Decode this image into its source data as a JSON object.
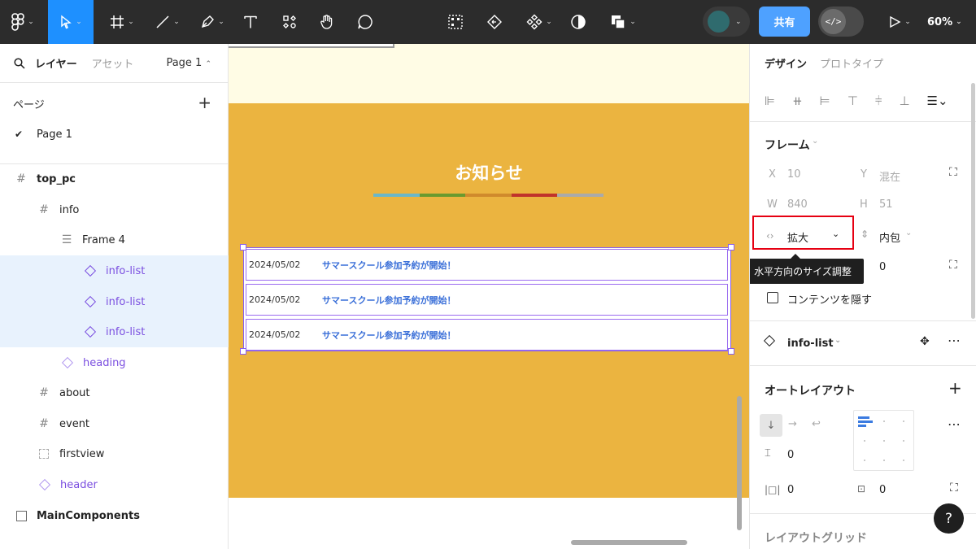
{
  "toolbar": {
    "share_label": "共有",
    "zoom_label": "60%",
    "dev_mode_label": "</>"
  },
  "left_panel": {
    "tab_layers": "レイヤー",
    "tab_assets": "アセット",
    "page_selector": "Page 1",
    "pages_heading": "ページ",
    "pages": [
      "Page 1"
    ],
    "layers": [
      {
        "name": "top_pc",
        "icon": "frame-icon"
      },
      {
        "name": "info",
        "icon": "frame-icon"
      },
      {
        "name": "Frame 4",
        "icon": "auto-layout-icon"
      },
      {
        "name": "info-list",
        "icon": "instance-icon"
      },
      {
        "name": "info-list",
        "icon": "instance-icon"
      },
      {
        "name": "info-list",
        "icon": "instance-icon"
      },
      {
        "name": "heading",
        "icon": "instance-icon"
      },
      {
        "name": "about",
        "icon": "frame-icon"
      },
      {
        "name": "event",
        "icon": "frame-icon"
      },
      {
        "name": "firstview",
        "icon": "section-icon"
      },
      {
        "name": "header",
        "icon": "instance-icon"
      },
      {
        "name": "MainComponents",
        "icon": "page-icon"
      }
    ]
  },
  "canvas": {
    "notice_title": "お知らせ",
    "colorbar_colors": [
      "#6ab7c9",
      "#6a9a2e",
      "#d08a2c",
      "#c1332b",
      "#aaaaaa"
    ],
    "rows": [
      {
        "date": "2024/05/02",
        "title": "サマースクール参加予約が開始！"
      },
      {
        "date": "2024/05/02",
        "title": "サマースクール参加予約が開始！"
      },
      {
        "date": "2024/05/02",
        "title": "サマースクール参加予約が開始！"
      }
    ]
  },
  "right_panel": {
    "tab_design": "デザイン",
    "tab_prototype": "プロトタイプ",
    "frame_title": "フレーム",
    "x_label": "X",
    "x_value": "10",
    "y_label": "Y",
    "y_value": "混在",
    "w_label": "W",
    "w_value": "840",
    "h_label": "H",
    "h_value": "51",
    "horizontal_resizing": "拡大",
    "vertical_resizing": "内包",
    "tooltip": "水平方向のサイズ調整",
    "min_value": "0",
    "clip_content": "コンテンツを隠す",
    "component_name": "info-list",
    "auto_layout_title": "オートレイアウト",
    "gap_value": "0",
    "padding_h": "0",
    "padding_v": "0",
    "layout_grid_title": "レイアウトグリッド",
    "help": "?"
  }
}
